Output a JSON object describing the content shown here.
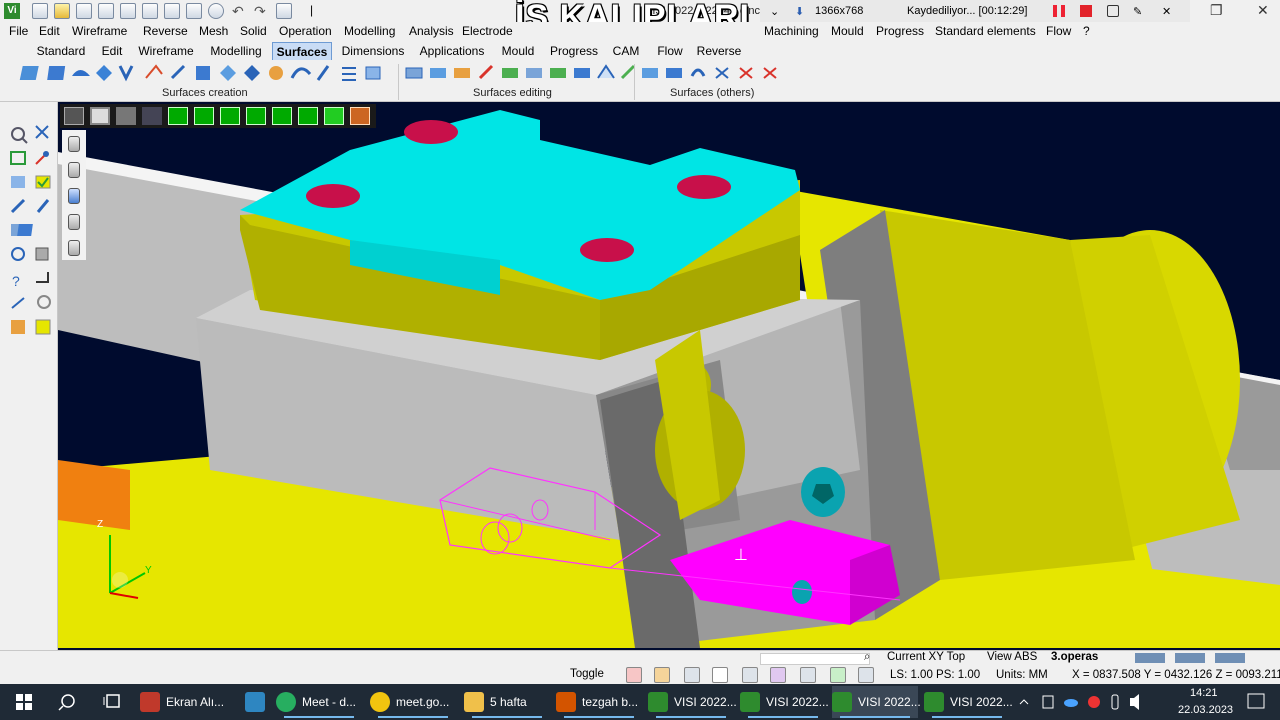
{
  "app": {
    "logo_text": "Vi",
    "window_title": "VISI 2022.1.2244 - c.nc",
    "overlay_title": "İŞ KALIPLARI",
    "recording": {
      "resolution": "1366x768",
      "status": "Kaydediliyor... [00:12:29]"
    },
    "controls": {
      "minimize": "—",
      "restore": "❐",
      "close": "✕"
    }
  },
  "menu": {
    "left": [
      "File",
      "Edit",
      "Wireframe",
      "Reverse",
      "Mesh",
      "Solid",
      "Operation",
      "Modelling",
      "Analysis",
      "Electrode"
    ],
    "right": [
      "Machining",
      "Mould",
      "Progress",
      "Standard elements",
      "Flow",
      "?"
    ]
  },
  "tabs": [
    {
      "label": "Standard",
      "active": false
    },
    {
      "label": "Edit",
      "active": false
    },
    {
      "label": "Wireframe",
      "active": false
    },
    {
      "label": "Modelling",
      "active": false
    },
    {
      "label": "Surfaces",
      "active": true
    },
    {
      "label": "Dimensions",
      "active": false
    },
    {
      "label": "Applications",
      "active": false
    },
    {
      "label": "Mould",
      "active": false
    },
    {
      "label": "Progress",
      "active": false
    },
    {
      "label": "CAM",
      "active": false
    },
    {
      "label": "Flow",
      "active": false
    },
    {
      "label": "Reverse",
      "active": false
    }
  ],
  "ribbon_groups": [
    {
      "label": "Surfaces creation"
    },
    {
      "label": "Surfaces editing"
    },
    {
      "label": "Surfaces (others)"
    }
  ],
  "status": {
    "toggle": "Toggle",
    "current_plane": "Current XY Top",
    "view": "View ABS",
    "operation": "3.operas",
    "ls_ps": "LS: 1.00 PS: 1.00",
    "units": "Units: MM",
    "coords": "X = 0837.508 Y = 0432.126 Z = 0093.211"
  },
  "taskbar": {
    "items": [
      {
        "label": "Ekran Alı...",
        "color": "#c0392b"
      },
      {
        "label": "",
        "color": "#2e86c1"
      },
      {
        "label": "Meet - d...",
        "color": "#27ae60"
      },
      {
        "label": "meet.go...",
        "color": "#f1c40f"
      },
      {
        "label": "5 hafta",
        "color": "#f0c04a"
      },
      {
        "label": "tezgah b...",
        "color": "#d35400"
      },
      {
        "label": "VISI 2022...",
        "color": "#2e8b2e"
      },
      {
        "label": "VISI 2022...",
        "color": "#2e8b2e"
      },
      {
        "label": "VISI 2022...",
        "color": "#2e8b2e"
      },
      {
        "label": "VISI 2022...",
        "color": "#2e8b2e"
      }
    ],
    "time": "14:21",
    "date": "22.03.2023"
  },
  "axes": {
    "z": "Z",
    "y": "Y"
  },
  "colors": {
    "viewport_bg": "#000b2e",
    "yellow": "#e6e600",
    "cyan": "#00e5e5",
    "grey": "#bcbcbc",
    "magenta": "#ff00ff"
  }
}
